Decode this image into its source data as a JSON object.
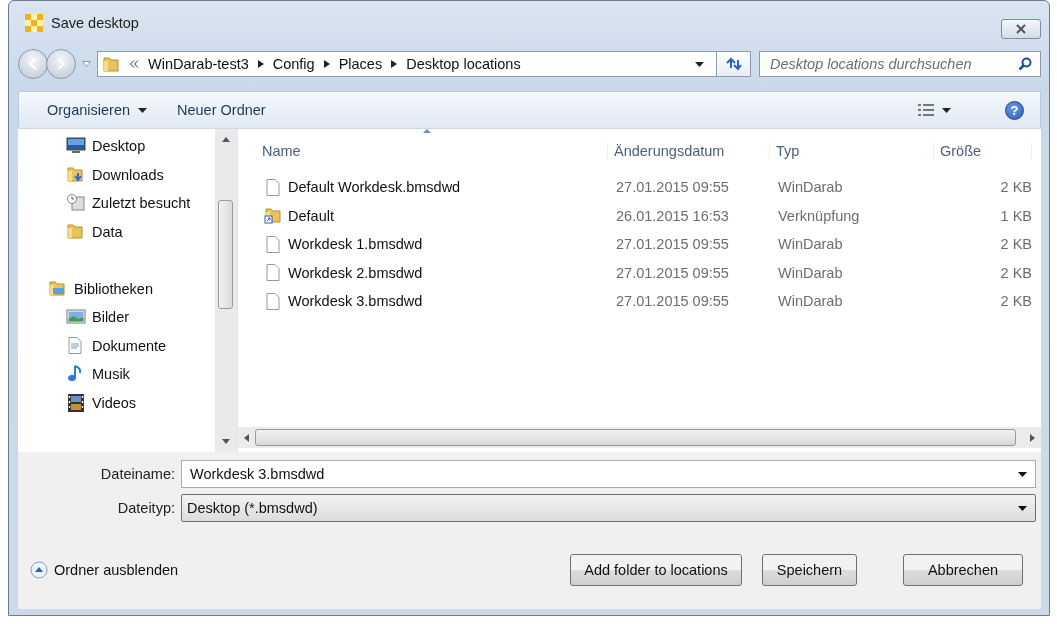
{
  "window": {
    "title": "Save desktop"
  },
  "address": {
    "crumbs": [
      "WinDarab-test3",
      "Config",
      "Places",
      "Desktop locations"
    ]
  },
  "search": {
    "placeholder": "Desktop locations durchsuchen"
  },
  "toolbar": {
    "organize": "Organisieren",
    "new_folder": "Neuer Ordner",
    "help": "?"
  },
  "nav": {
    "items": [
      {
        "label": "Desktop"
      },
      {
        "label": "Downloads"
      },
      {
        "label": "Zuletzt besucht"
      },
      {
        "label": "Data"
      }
    ],
    "libraries": {
      "label": "Bibliotheken",
      "children": [
        {
          "label": "Bilder"
        },
        {
          "label": "Dokumente"
        },
        {
          "label": "Musik"
        },
        {
          "label": "Videos"
        }
      ]
    }
  },
  "table": {
    "columns": [
      "Name",
      "Änderungsdatum",
      "Typ",
      "Größe"
    ],
    "rows": [
      {
        "kind": "file",
        "name": "Default Workdesk.bmsdwd",
        "date": "27.01.2015 09:55",
        "type": "WinDarab",
        "size": "2 KB"
      },
      {
        "kind": "shortcut",
        "name": "Default",
        "date": "26.01.2015 16:53",
        "type": "Verknüpfung",
        "size": "1 KB"
      },
      {
        "kind": "file",
        "name": "Workdesk 1.bmsdwd",
        "date": "27.01.2015 09:55",
        "type": "WinDarab",
        "size": "2 KB"
      },
      {
        "kind": "file",
        "name": "Workdesk 2.bmsdwd",
        "date": "27.01.2015 09:55",
        "type": "WinDarab",
        "size": "2 KB"
      },
      {
        "kind": "file",
        "name": "Workdesk 3.bmsdwd",
        "date": "27.01.2015 09:55",
        "type": "WinDarab",
        "size": "2 KB"
      }
    ]
  },
  "filename": {
    "label": "Dateiname:",
    "value": "Workdesk 3.bmsdwd"
  },
  "filetype": {
    "label": "Dateityp:",
    "value": "Desktop (*.bmsdwd)"
  },
  "hide_folders": "Ordner ausblenden",
  "buttons": [
    "Add folder to locations",
    "Speichern",
    "Abbrechen"
  ]
}
